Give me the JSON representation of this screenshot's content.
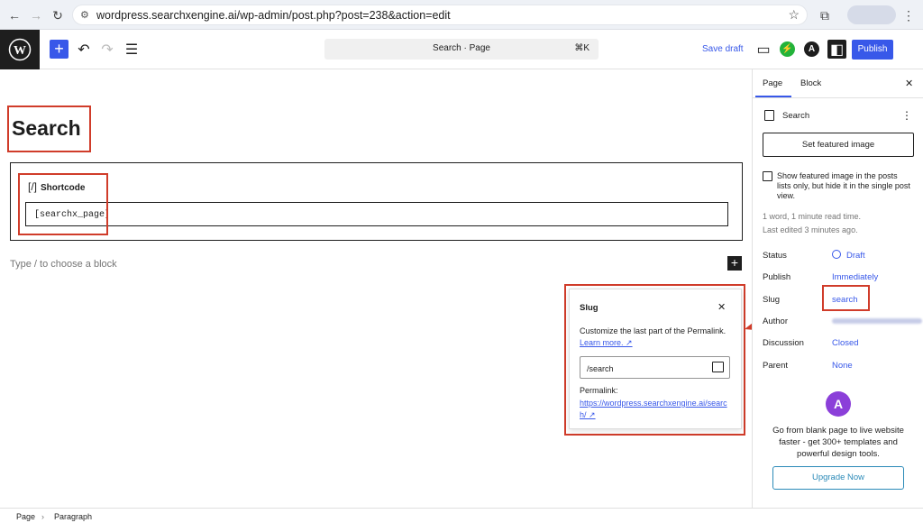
{
  "browser": {
    "url": "wordpress.searchxengine.ai/wp-admin/post.php?post=238&action=edit"
  },
  "toolbar": {
    "command_title": "Search · Page",
    "command_shortcut": "⌘K",
    "save_draft_label": "Save draft",
    "publish_label": "Publish"
  },
  "editor": {
    "page_title": "Search",
    "shortcode_block_label": "Shortcode",
    "shortcode_icon": "[/]",
    "shortcode_value": "[searchx_page]",
    "block_hint": "Type / to choose a block"
  },
  "slug_popover": {
    "title": "Slug",
    "description": "Customize the last part of the Permalink.",
    "learn_more": "Learn more. ↗",
    "slug_value": "/search",
    "permalink_label": "Permalink:",
    "permalink_url": "https://wordpress.searchxengine.ai/search/ ↗"
  },
  "sidebar": {
    "tab_page": "Page",
    "tab_block": "Block",
    "doc_title": "Search",
    "featured_image_button": "Set featured image",
    "featured_checkbox_label": "Show featured image in the posts lists only, but hide it in the single post view.",
    "word_count": "1 word, 1 minute read time.",
    "last_edited": "Last edited 3 minutes ago.",
    "rows": {
      "status_label": "Status",
      "status_value": "Draft",
      "publish_label": "Publish",
      "publish_value": "Immediately",
      "slug_label": "Slug",
      "slug_value": "search",
      "author_label": "Author",
      "discussion_label": "Discussion",
      "discussion_value": "Closed",
      "parent_label": "Parent",
      "parent_value": "None"
    },
    "promo_text": "Go from blank page to live website faster - get 300+ templates and powerful design tools.",
    "upgrade_button": "Upgrade Now"
  },
  "footer": {
    "crumb_page": "Page",
    "crumb_separator": "›",
    "crumb_paragraph": "Paragraph"
  },
  "colors": {
    "accent": "#3858e9",
    "highlight": "#d03c2a",
    "promo": "#8b3fd9"
  }
}
